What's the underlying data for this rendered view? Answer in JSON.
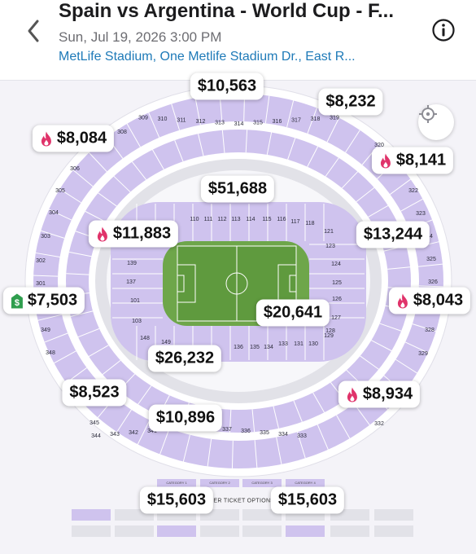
{
  "header": {
    "title": "Spain vs Argentina - World Cup - F...",
    "date": "Sun, Jul 19, 2026 3:00 PM",
    "venue": "MetLife Stadium, One Metlife Stadium Dr., East R..."
  },
  "icons": {
    "back": "chevron-left-icon",
    "info": "info-icon",
    "locate": "crosshair-icon",
    "hot": "fire-icon",
    "deal": "dollar-tag-icon"
  },
  "colors": {
    "section": "#cfc3ee",
    "section_light": "#e2e2e8",
    "field": "#5f9a3e",
    "fire": "#e0336a",
    "deal": "#2f9e4e",
    "venue_link": "#1e7ab8"
  },
  "price_pins": [
    {
      "text": "$10,563",
      "icon": ""
    },
    {
      "text": "$8,232",
      "icon": ""
    },
    {
      "text": "$8,084",
      "icon": "fire"
    },
    {
      "text": "$8,141",
      "icon": "fire"
    },
    {
      "text": "$51,688",
      "icon": ""
    },
    {
      "text": "$11,883",
      "icon": "fire"
    },
    {
      "text": "$13,244",
      "icon": ""
    },
    {
      "text": "$7,503",
      "icon": "deal"
    },
    {
      "text": "$8,043",
      "icon": "fire"
    },
    {
      "text": "$20,641",
      "icon": ""
    },
    {
      "text": "$26,232",
      "icon": ""
    },
    {
      "text": "$8,523",
      "icon": ""
    },
    {
      "text": "$8,934",
      "icon": "fire"
    },
    {
      "text": "$10,896",
      "icon": ""
    },
    {
      "text": "$15,603",
      "icon": ""
    },
    {
      "text": "$15,603",
      "icon": ""
    }
  ],
  "upper_sections": [
    "309",
    "310",
    "311",
    "312",
    "313",
    "314",
    "315",
    "316",
    "317",
    "318",
    "319"
  ],
  "lower_sections": [
    "344",
    "343",
    "342",
    "341",
    "340",
    "339",
    "338",
    "337",
    "336",
    "335",
    "334",
    "333"
  ],
  "left_sections": [
    "308",
    "306",
    "305",
    "304",
    "303",
    "302",
    "301",
    "349",
    "348",
    "345"
  ],
  "right_sections": [
    "320",
    "322",
    "323",
    "324",
    "325",
    "326",
    "327",
    "328",
    "329",
    "331",
    "332"
  ],
  "inner_sections": [
    "110",
    "111",
    "112",
    "113",
    "114",
    "115",
    "116",
    "117",
    "118",
    "121",
    "123",
    "124",
    "125",
    "126",
    "127",
    "128",
    "129",
    "130",
    "131",
    "133",
    "134",
    "135",
    "136",
    "137",
    "139",
    "101",
    "103",
    "148",
    "149",
    "146",
    "144"
  ],
  "other_ticket_options": {
    "label": "OTHER TICKET OPTIONS",
    "categories": [
      "CATEGORY 1",
      "CATEGORY 2",
      "CATEGORY 3",
      "CATEGORY 4"
    ]
  }
}
